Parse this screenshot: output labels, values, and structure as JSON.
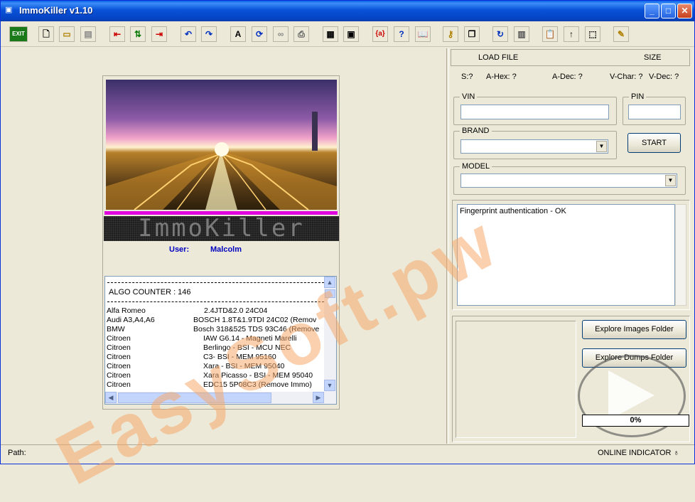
{
  "window": {
    "title": "ImmoKiller v1.10",
    "min": "_",
    "max": "□",
    "close": "✕"
  },
  "toolbar": {
    "exit": "EXIT",
    "icons": [
      "new-file-icon",
      "open-folder-icon",
      "save-icon",
      "import-icon",
      "swap-icon",
      "export-icon",
      "undo-icon",
      "redo-icon",
      "text-icon",
      "refresh-doc-icon",
      "binoculars-icon",
      "printer-icon",
      "calculator-icon",
      "chip-icon",
      "braces-icon",
      "help-icon",
      "book-icon",
      "key-icon",
      "copy-icon",
      "reload-icon",
      "memory-icon",
      "paste-icon",
      "up-arrow-icon",
      "select-icon",
      "pen-icon"
    ]
  },
  "left": {
    "led_text": "ImmoKiller",
    "user_label": "User:",
    "user_value": "Malcolm",
    "algo_counter": "ALGO COUNTER : 146",
    "rows": [
      {
        "brand": "Alfa Romeo",
        "model": "2.4JTD&2.0    24C04"
      },
      {
        "brand": "Audi A3,A4,A6",
        "model": "BOSCH 1.8T&1.9TDI   24C02 (Remov"
      },
      {
        "brand": "BMW",
        "model": "Bosch 318&525 TDS 93C46 (Remove"
      },
      {
        "brand": "Citroen",
        "model": "IAW G6.14 - Magneti Marelli"
      },
      {
        "brand": "Citroen",
        "model": "Berlingo - BSI - MCU NEC"
      },
      {
        "brand": "Citroen",
        "model": "C3- BSI - MEM 95160"
      },
      {
        "brand": "Citroen",
        "model": "Xara - BSI - MEM 95040"
      },
      {
        "brand": "Citroen",
        "model": "Xara Picasso     - BSI - MEM 95040"
      },
      {
        "brand": "Citroen",
        "model": "EDC15 5P08C3 (Remove Immo)"
      }
    ]
  },
  "right": {
    "load_file": "LOAD FILE",
    "size": "SIZE",
    "s": "S:?",
    "a_hex": "A-Hex: ?",
    "a_dec": "A-Dec: ?",
    "v_char": "V-Char: ?",
    "v_dec": "V-Dec: ?",
    "vin_label": "VIN",
    "vin_value": "",
    "pin_label": "PIN",
    "pin_value": "",
    "brand_label": "BRAND",
    "brand_value": "",
    "start": "START",
    "model_label": "MODEL",
    "model_value": "",
    "log_text": "Fingerprint authentication - OK",
    "explore_images": "Explore Images Folder",
    "explore_dumps": "Explore Dumps Folder",
    "progress": "0%"
  },
  "status": {
    "path_label": "Path:",
    "online": "ONLINE INDICATOR"
  },
  "watermark": "EasySoft.pw"
}
